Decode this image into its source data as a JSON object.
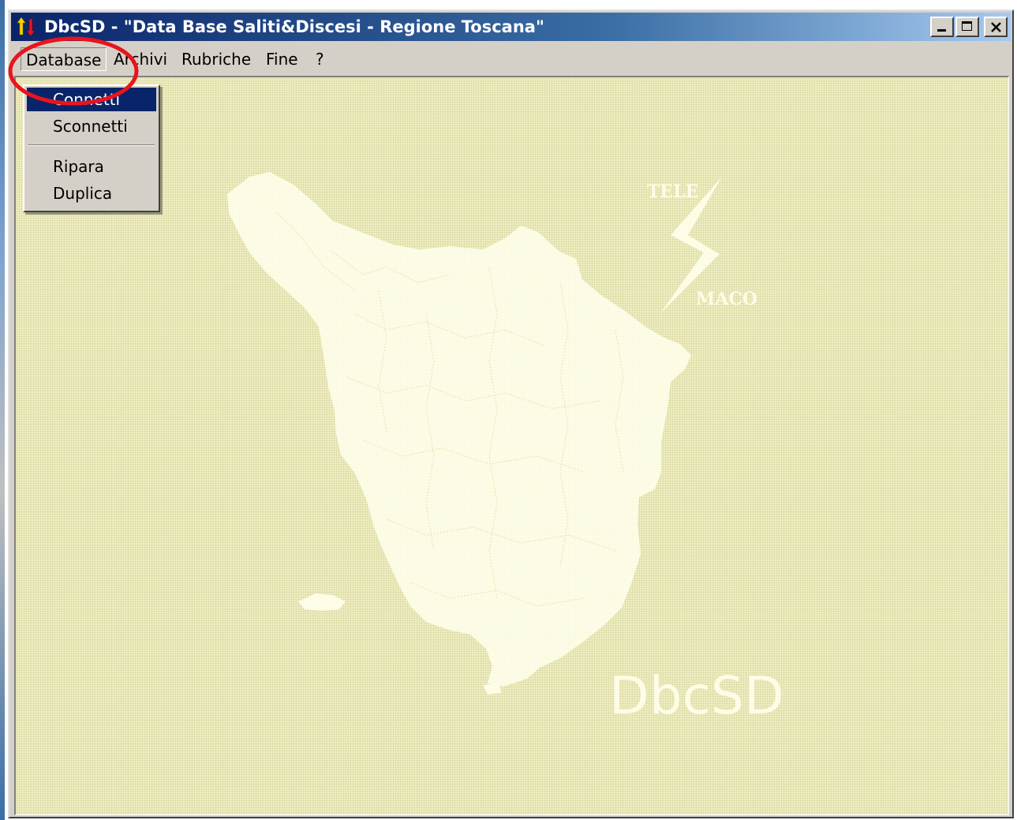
{
  "window": {
    "title": "DbcSD - \"Data Base Saliti&Discesi - Regione Toscana\""
  },
  "menubar": {
    "items": [
      {
        "label": "Database"
      },
      {
        "label": "Archivi"
      },
      {
        "label": "Rubriche"
      },
      {
        "label": "Fine"
      },
      {
        "label": "?"
      }
    ]
  },
  "dropdown": {
    "items": [
      {
        "label": "Connetti",
        "selected": true
      },
      {
        "label": "Sconnetti"
      },
      {
        "label": "Ripara"
      },
      {
        "label": "Duplica"
      }
    ]
  },
  "watermark": {
    "logo_top": "TELE",
    "logo_bottom": "MACO",
    "app_name": "DbcSD"
  },
  "colors": {
    "background": "#eeeec0",
    "map_fill": "#fdfce6",
    "highlight": "#0a246a",
    "annotation": "#e8141e"
  },
  "icons": {
    "app": "up-down-arrows-icon",
    "minimize": "minimize-icon",
    "maximize": "maximize-icon",
    "close": "close-icon"
  }
}
